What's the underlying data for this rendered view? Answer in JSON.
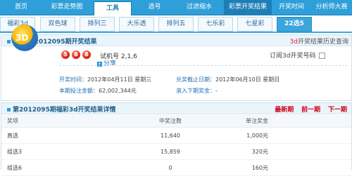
{
  "topnav": {
    "items": [
      "首页",
      "彩票走势图",
      "工具",
      "选号",
      "过滤缩水",
      "彩票开奖结果",
      "开奖时间",
      "分析师大赛"
    ]
  },
  "tabs": [
    "福彩3d",
    "双色球",
    "排列三",
    "大乐透",
    "排列五",
    "七乐彩",
    "七星彩",
    "22选5"
  ],
  "draw": {
    "title": "福彩3d2012095期开奖结果",
    "history_prefix": "3d",
    "history_text": "开奖结果历史查询",
    "balls": [
      "5",
      "8",
      "8"
    ],
    "trial_label": "试机号",
    "trial_value": "2,1,6",
    "share": "分享",
    "subscribe": "订阅3d开奖号码",
    "open_time_label": "开奖时间：",
    "open_time_value": "2012年04月11日 星期三",
    "deadline_label": "兑奖截止日期：",
    "deadline_value": "2012年06月10日 星期日",
    "sales_label": "本期投注金额：",
    "sales_value": "62,002,344元",
    "pool_label": "滚入下期奖金：",
    "pool_value": "-",
    "logo_text": "3D"
  },
  "detail": {
    "title": "第2012095期福彩3d开奖结果详情",
    "links": [
      "最新期",
      "前一期",
      "下一期"
    ],
    "headers": [
      "奖项",
      "中奖注数",
      "单注奖金"
    ],
    "rows": [
      {
        "prize": "直选",
        "count": "11,640",
        "amount": "1,000元"
      },
      {
        "prize": "组选3",
        "count": "15,859",
        "amount": "320元"
      },
      {
        "prize": "组选6",
        "count": "0",
        "amount": "160元"
      }
    ]
  }
}
